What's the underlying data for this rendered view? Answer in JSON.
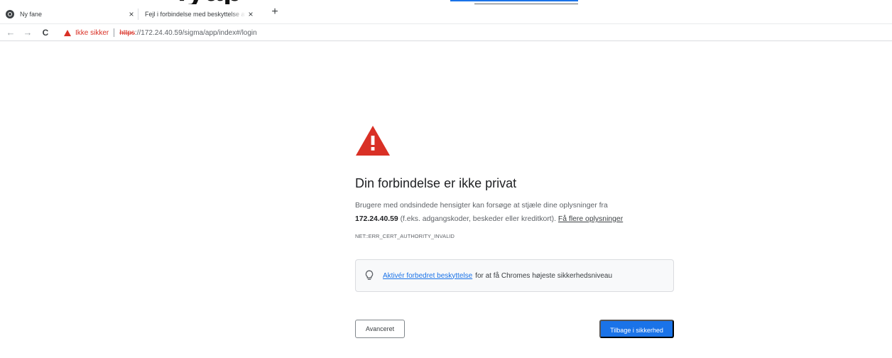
{
  "tabs": [
    {
      "title": "Ny fane",
      "close": "×"
    },
    {
      "title": "Fejl i forbindelse med beskyttelse af p",
      "close": "×"
    }
  ],
  "new_tab_symbol": "+",
  "overlay_text": "lyap",
  "toolbar": {
    "back_symbol": "←",
    "forward_symbol": "→",
    "reload_symbol": "C",
    "security_label": "Ikke sikker",
    "url_scheme": "https",
    "url_rest": "://172.24.40.59/sigma/app/index#/login"
  },
  "interstitial": {
    "heading": "Din forbindelse er ikke privat",
    "explanation_part1": "Brugere med ondsindede hensigter kan forsøge at stjæle dine oplysninger fra",
    "host": "172.24.40.59",
    "explanation_part2": "(f.eks. adgangskoder, beskeder eller kreditkort).",
    "learn_more": "Få flere oplysninger",
    "error_code": "NET::ERR_CERT_AUTHORITY_INVALID",
    "enhanced_link": "Aktivér forbedret beskyttelse",
    "enhanced_rest": "for at få Chromes højeste sikkerhedsniveau",
    "advanced_button": "Avanceret",
    "back_button": "Tilbage i sikkerhed"
  },
  "colors": {
    "danger": "#d93025",
    "primary": "#1a73e8",
    "text": "#202124",
    "secondary_text": "#5f6368"
  },
  "icons": [
    "chrome-favicon-icon",
    "close-icon",
    "plus-icon",
    "back-arrow-icon",
    "forward-arrow-icon",
    "reload-icon",
    "warning-triangle-icon",
    "lightbulb-icon"
  ]
}
